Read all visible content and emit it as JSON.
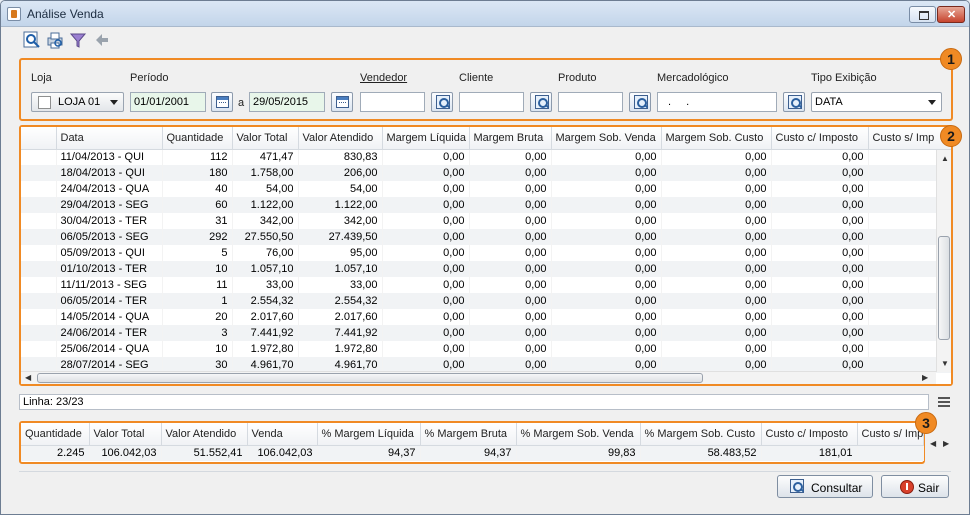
{
  "window": {
    "title": "Análise Venda"
  },
  "toolbar": {
    "icons": [
      "search-icon",
      "print-icon",
      "filter-icon",
      "back-arrow-icon"
    ]
  },
  "badges": [
    "1",
    "2",
    "3"
  ],
  "filters": {
    "loja_label": "Loja",
    "loja_value": "LOJA 01",
    "periodo_label": "Período",
    "periodo_from": "01/01/2001",
    "periodo_sep": "a",
    "periodo_to": "29/05/2015",
    "vendedor_label": "Vendedor",
    "vendedor_value": "",
    "cliente_label": "Cliente",
    "cliente_value": "",
    "produto_label": "Produto",
    "produto_value": "",
    "mercadologico_label": "Mercadológico",
    "mercadologico_value": ". .",
    "tipo_label": "Tipo Exibição",
    "tipo_value": "DATA"
  },
  "grid": {
    "columns": [
      "Data",
      "Quantidade",
      "Valor Total",
      "Valor Atendido",
      "Margem Líquida",
      "Margem Bruta",
      "Margem Sob. Venda",
      "Margem Sob. Custo",
      "Custo c/ Imposto",
      "Custo s/ Imp"
    ],
    "rows": [
      [
        "11/04/2013 - QUI",
        "112",
        "471,47",
        "830,83",
        "0,00",
        "0,00",
        "0,00",
        "0,00",
        "0,00"
      ],
      [
        "18/04/2013 - QUI",
        "180",
        "1.758,00",
        "206,00",
        "0,00",
        "0,00",
        "0,00",
        "0,00",
        "0,00"
      ],
      [
        "24/04/2013 - QUA",
        "40",
        "54,00",
        "54,00",
        "0,00",
        "0,00",
        "0,00",
        "0,00",
        "0,00"
      ],
      [
        "29/04/2013 - SEG",
        "60",
        "1.122,00",
        "1.122,00",
        "0,00",
        "0,00",
        "0,00",
        "0,00",
        "0,00"
      ],
      [
        "30/04/2013 - TER",
        "31",
        "342,00",
        "342,00",
        "0,00",
        "0,00",
        "0,00",
        "0,00",
        "0,00"
      ],
      [
        "06/05/2013 - SEG",
        "292",
        "27.550,50",
        "27.439,50",
        "0,00",
        "0,00",
        "0,00",
        "0,00",
        "0,00"
      ],
      [
        "05/09/2013 - QUI",
        "5",
        "76,00",
        "95,00",
        "0,00",
        "0,00",
        "0,00",
        "0,00",
        "0,00"
      ],
      [
        "01/10/2013 - TER",
        "10",
        "1.057,10",
        "1.057,10",
        "0,00",
        "0,00",
        "0,00",
        "0,00",
        "0,00"
      ],
      [
        "11/11/2013 - SEG",
        "11",
        "33,00",
        "33,00",
        "0,00",
        "0,00",
        "0,00",
        "0,00",
        "0,00"
      ],
      [
        "06/05/2014 - TER",
        "1",
        "2.554,32",
        "2.554,32",
        "0,00",
        "0,00",
        "0,00",
        "0,00",
        "0,00"
      ],
      [
        "14/05/2014 - QUA",
        "20",
        "2.017,60",
        "2.017,60",
        "0,00",
        "0,00",
        "0,00",
        "0,00",
        "0,00"
      ],
      [
        "24/06/2014 - TER",
        "3",
        "7.441,92",
        "7.441,92",
        "0,00",
        "0,00",
        "0,00",
        "0,00",
        "0,00"
      ],
      [
        "25/06/2014 - QUA",
        "10",
        "1.972,80",
        "1.972,80",
        "0,00",
        "0,00",
        "0,00",
        "0,00",
        "0,00"
      ],
      [
        "28/07/2014 - SEG",
        "30",
        "4.961,70",
        "4.961,70",
        "0,00",
        "0,00",
        "0,00",
        "0,00",
        "0,00"
      ]
    ]
  },
  "status": {
    "linha": "Linha: 23/23"
  },
  "totals": {
    "columns": [
      "Quantidade",
      "Valor Total",
      "Valor Atendido",
      "Venda",
      "% Margem Líquida",
      "% Margem Bruta",
      "% Margem Sob. Venda",
      "% Margem Sob. Custo",
      "Custo c/ Imposto",
      "Custo s/ Imp"
    ],
    "values": [
      "2.245",
      "106.042,03",
      "51.552,41",
      "106.042,03",
      "94,37",
      "94,37",
      "99,83",
      "58.483,52",
      "181,01",
      ""
    ]
  },
  "buttons": {
    "consultar": "Consultar",
    "sair": "Sair"
  }
}
